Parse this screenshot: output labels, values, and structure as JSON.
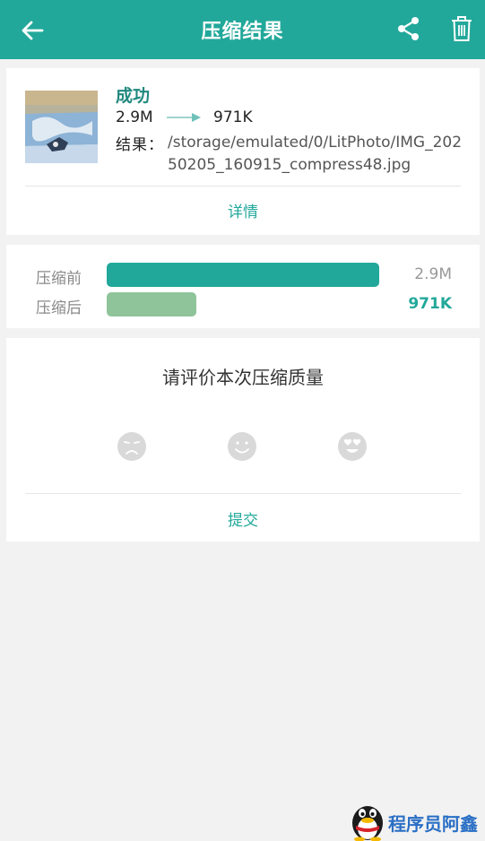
{
  "header": {
    "title": "压缩结果",
    "back_icon": "arrow-left-icon",
    "share_icon": "share-icon",
    "delete_icon": "trash-icon"
  },
  "result": {
    "status": "成功",
    "size_before": "2.9M",
    "size_after": "971K",
    "path_label": "结果：",
    "path_value": "/storage/emulated/0/LitPhoto/IMG_20250205_160915_compress48.jpg",
    "details_label": "详情"
  },
  "comparison": {
    "before_label": "压缩前",
    "before_value": "2.9M",
    "before_fraction": 1.0,
    "after_label": "压缩后",
    "after_value": "971K",
    "after_fraction": 0.33
  },
  "rating": {
    "title": "请评价本次压缩质量",
    "faces": [
      "sad-face-icon",
      "smile-face-icon",
      "heart-eyes-face-icon"
    ],
    "submit_label": "提交"
  },
  "watermark": {
    "text": "程序员阿鑫"
  },
  "colors": {
    "primary": "#22a89a",
    "bar_after": "#8fc49a",
    "background": "#f2f2f2",
    "face": "#d9d9d9"
  }
}
